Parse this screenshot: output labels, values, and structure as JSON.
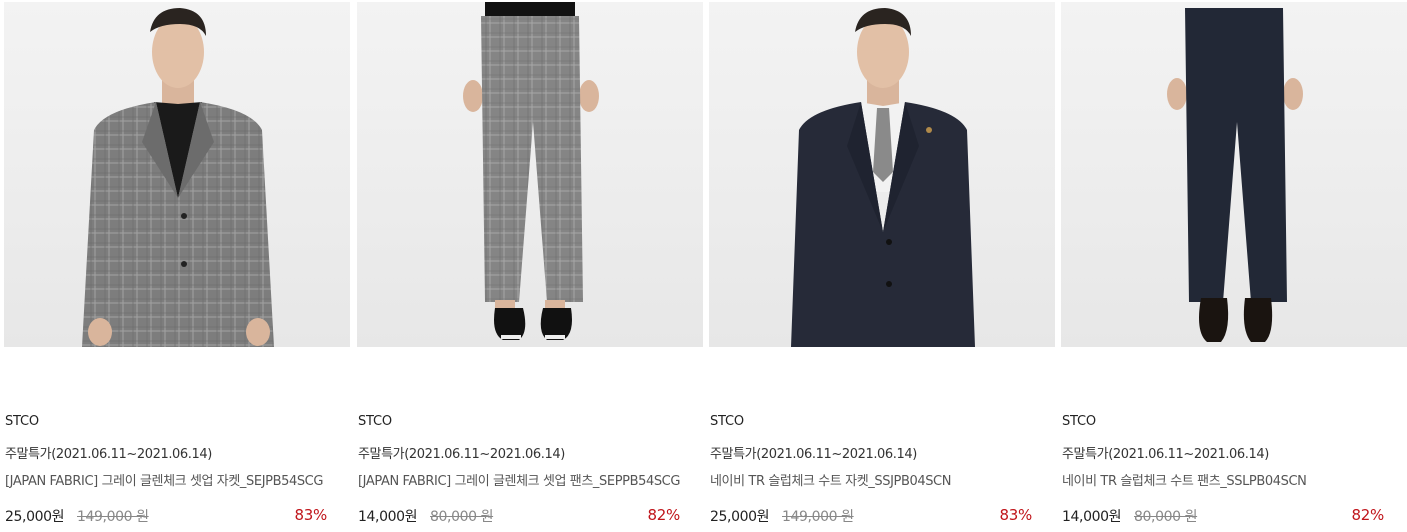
{
  "colors": {
    "discount": "#c0151b",
    "background": "#ffffff"
  },
  "products": [
    {
      "brand": "STCO",
      "promo": "주말특가(2021.06.11~2021.06.14)",
      "name": "[JAPAN FABRIC] 그레이 글렌체크 셋업 자켓_SEJPB54SCG",
      "price": "25,000원",
      "original_price": "149,000 원",
      "discount": "83%",
      "image": "gray-glen-check-jacket-photo"
    },
    {
      "brand": "STCO",
      "promo": "주말특가(2021.06.11~2021.06.14)",
      "name": "[JAPAN FABRIC] 그레이 글렌체크 셋업 팬츠_SEPPB54SCG",
      "price": "14,000원",
      "original_price": "80,000 원",
      "discount": "82%",
      "image": "gray-glen-check-pants-photo"
    },
    {
      "brand": "STCO",
      "promo": "주말특가(2021.06.11~2021.06.14)",
      "name": "네이비 TR 슬럽체크 수트 자켓_SSJPB04SCN",
      "price": "25,000원",
      "original_price": "149,000 원",
      "discount": "83%",
      "image": "navy-suit-jacket-photo"
    },
    {
      "brand": "STCO",
      "promo": "주말특가(2021.06.11~2021.06.14)",
      "name": "네이비 TR 슬럽체크 수트 팬츠_SSLPB04SCN",
      "price": "14,000원",
      "original_price": "80,000 원",
      "discount": "82%",
      "image": "navy-suit-pants-photo"
    }
  ]
}
